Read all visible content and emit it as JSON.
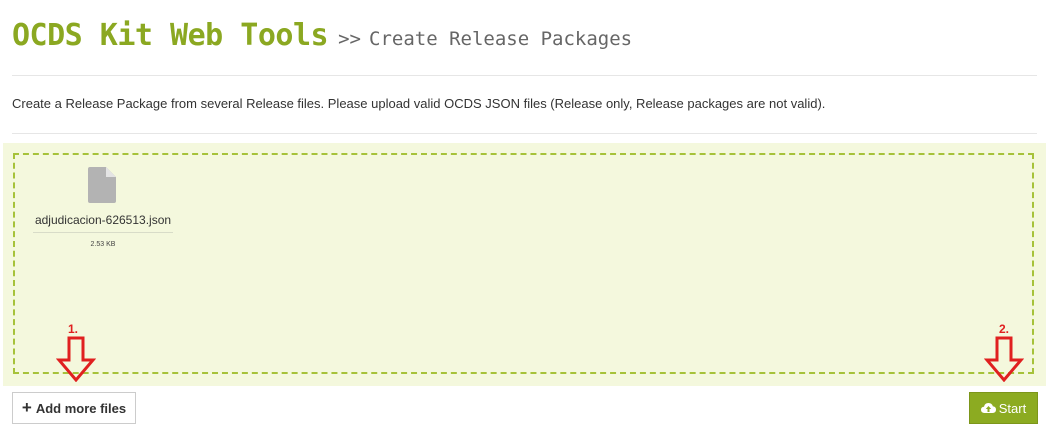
{
  "header": {
    "app_title": "OCDS Kit Web Tools",
    "breadcrumb_separator": ">>",
    "page_title": "Create Release Packages"
  },
  "description": "Create a Release Package from several Release files. Please upload valid OCDS JSON files (Release only, Release packages are not valid).",
  "dropzone": {
    "files": [
      {
        "icon": "file-icon",
        "name": "adjudicacion-626513.json",
        "size": "2.53 KB"
      }
    ]
  },
  "annotations": {
    "step1": "1.",
    "step2": "2."
  },
  "buttons": {
    "add_more_files": "Add more files",
    "add_icon": "plus-icon",
    "start": "Start",
    "start_icon": "cloud-upload-icon"
  },
  "colors": {
    "brand": "#8ba821",
    "dropzone_bg": "#f4f8dd",
    "dropzone_border": "#a6c23a",
    "annotation": "#e02020",
    "start_button_bg": "#8cab21"
  }
}
